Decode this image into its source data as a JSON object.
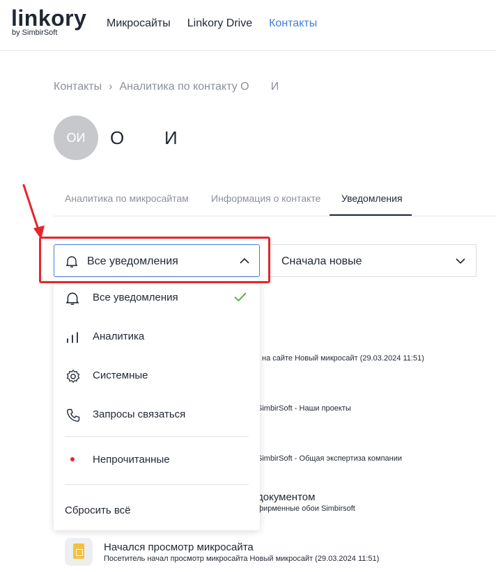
{
  "header": {
    "logo_main": "linkory",
    "logo_sub": "by SimbirSoft",
    "nav": [
      {
        "label": "Микросайты",
        "active": false
      },
      {
        "label": "Linkory Drive",
        "active": false
      },
      {
        "label": "Контакты",
        "active": true
      }
    ]
  },
  "breadcrumb": {
    "root": "Контакты",
    "separator": "›",
    "current": "Аналитика по контакту О       И"
  },
  "contact": {
    "initials": "ОИ",
    "name": "О        И"
  },
  "tabs": [
    {
      "label": "Аналитика по микросайтам",
      "active": false
    },
    {
      "label": "Информация о контакте",
      "active": false
    },
    {
      "label": "Уведомления",
      "active": true
    }
  ],
  "filter": {
    "selected": "Все уведомления",
    "options": [
      {
        "label": "Все уведомления",
        "icon": "bell-icon",
        "checked": true
      },
      {
        "label": "Аналитика",
        "icon": "bar-chart-icon",
        "checked": false
      },
      {
        "label": "Системные",
        "icon": "gear-icon",
        "checked": false
      },
      {
        "label": "Запросы связаться",
        "icon": "phone-icon",
        "checked": false
      },
      {
        "label": "Непрочитанные",
        "icon": "red-dot-icon",
        "checked": false
      }
    ],
    "reset_label": "Сбросить всё"
  },
  "sort": {
    "selected": "Сначала новые"
  },
  "background_notifications": [
    {
      "text": "на сайте Новый микросайт (29.03.2024 11:51)"
    },
    {
      "text": "SimbirSoft - Наши проекты"
    },
    {
      "text": "SimbirSoft - Общая экспертиза компании"
    },
    {
      "title": "документом",
      "text": "фирменные обои Simbirsoft"
    }
  ],
  "last_notification": {
    "title": "Начался просмотр микросайта",
    "text": "Посетитель начал просмотр микросайта Новый микросайт (29.03.2024 11:51)"
  },
  "colors": {
    "accent": "#3f7fd6",
    "highlight": "#e8232a",
    "check": "#5bb24a"
  }
}
